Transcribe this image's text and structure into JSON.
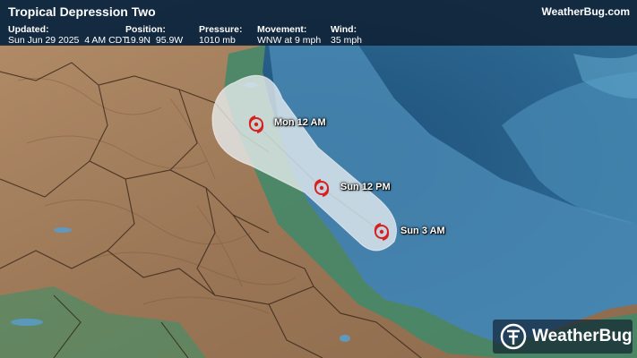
{
  "header": {
    "title": "Tropical Depression Two",
    "brand": "WeatherBug.com",
    "fields": [
      {
        "label": "Updated:",
        "value": "Sun Jun 29 2025  4 AM CDT"
      },
      {
        "label": "Position:",
        "value": "19.9N  95.9W"
      },
      {
        "label": "Pressure:",
        "value": "1010 mb"
      },
      {
        "label": "Movement:",
        "value": "WNW at 9 mph"
      },
      {
        "label": "Wind:",
        "value": "35 mph"
      }
    ]
  },
  "forecast_points": [
    {
      "label": "Mon 12 AM"
    },
    {
      "label": "Sun 12 PM"
    },
    {
      "label": "Sun 3 AM"
    }
  ],
  "logo": {
    "text": "WeatherBug"
  },
  "colors": {
    "header_bg": "#0e1c2e",
    "land": "#a07c5a",
    "ocean": "#2e6a94",
    "cone": "#e6ecef",
    "storm_icon": "#d82020"
  },
  "icons": {
    "storm": "tropical-depression-icon",
    "logo": "weatherbug-logo-icon"
  }
}
